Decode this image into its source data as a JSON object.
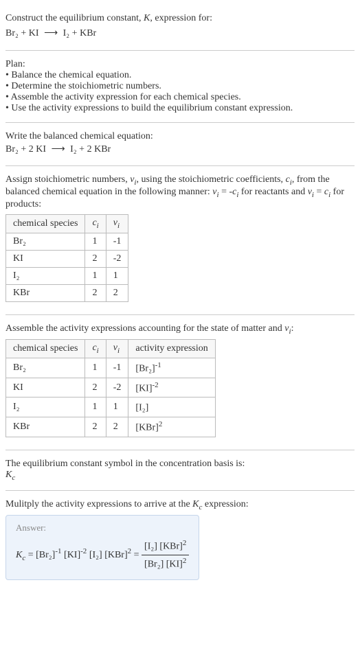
{
  "prompt": {
    "line1": "Construct the equilibrium constant, K, expression for:",
    "eq_lhs": "Br₂ + KI",
    "eq_arrow": "⟶",
    "eq_rhs": "I₂ + KBr"
  },
  "plan": {
    "title": "Plan:",
    "items": [
      "• Balance the chemical equation.",
      "• Determine the stoichiometric numbers.",
      "• Assemble the activity expression for each chemical species.",
      "• Use the activity expressions to build the equilibrium constant expression."
    ]
  },
  "balanced": {
    "title": "Write the balanced chemical equation:",
    "eq_lhs": "Br₂ + 2 KI",
    "eq_arrow": "⟶",
    "eq_rhs": "I₂ + 2 KBr"
  },
  "assign": {
    "text": "Assign stoichiometric numbers, νᵢ, using the stoichiometric coefficients, cᵢ, from the balanced chemical equation in the following manner: νᵢ = -cᵢ for reactants and νᵢ = cᵢ for products:"
  },
  "table1": {
    "headers": [
      "chemical species",
      "cᵢ",
      "νᵢ"
    ],
    "rows": [
      {
        "sp": "Br₂",
        "c": "1",
        "v": "-1"
      },
      {
        "sp": "KI",
        "c": "2",
        "v": "-2"
      },
      {
        "sp": "I₂",
        "c": "1",
        "v": "1"
      },
      {
        "sp": "KBr",
        "c": "2",
        "v": "2"
      }
    ]
  },
  "assemble": {
    "text": "Assemble the activity expressions accounting for the state of matter and νᵢ:"
  },
  "table2": {
    "headers": [
      "chemical species",
      "cᵢ",
      "νᵢ",
      "activity expression"
    ],
    "rows": [
      {
        "sp": "Br₂",
        "c": "1",
        "v": "-1",
        "a_base": "[Br₂]",
        "a_exp": "-1"
      },
      {
        "sp": "KI",
        "c": "2",
        "v": "-2",
        "a_base": "[KI]",
        "a_exp": "-2"
      },
      {
        "sp": "I₂",
        "c": "1",
        "v": "1",
        "a_base": "[I₂]",
        "a_exp": ""
      },
      {
        "sp": "KBr",
        "c": "2",
        "v": "2",
        "a_base": "[KBr]",
        "a_exp": "2"
      }
    ]
  },
  "basis": {
    "line1": "The equilibrium constant symbol in the concentration basis is:",
    "symbol": "K_c"
  },
  "multiply": {
    "text": "Mulitply the activity expressions to arrive at the K_c expression:"
  },
  "answer": {
    "label": "Answer:",
    "lhs_sym": "K_c",
    "t1_base": "[Br₂]",
    "t1_exp": "-1",
    "t2_base": "[KI]",
    "t2_exp": "-2",
    "t3_base": "[I₂]",
    "t3_exp": "",
    "t4_base": "[KBr]",
    "t4_exp": "2",
    "num1_base": "[I₂]",
    "num1_exp": "",
    "num2_base": "[KBr]",
    "num2_exp": "2",
    "den1_base": "[Br₂]",
    "den1_exp": "",
    "den2_base": "[KI]",
    "den2_exp": "2"
  }
}
